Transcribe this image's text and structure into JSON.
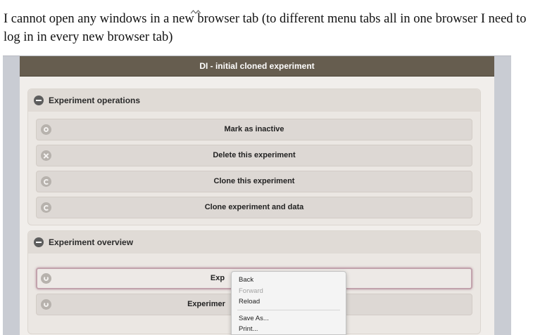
{
  "question_text": "I cannot open any windows in a new browser tab (to different menu tabs all in one browser I need to log in in every new browser tab)",
  "question": {
    "part1": "I cannot open any windows in a new",
    "part2": " browser tab (to different menu tabs all in one browser I need to log in in every new browser tab)"
  },
  "app": {
    "title": "DI - initial cloned experiment"
  },
  "sections": {
    "operations": {
      "title": "Experiment operations",
      "buttons": [
        {
          "label": "Mark as inactive",
          "icon": "gear-icon"
        },
        {
          "label": "Delete this experiment",
          "icon": "delete-icon"
        },
        {
          "label": "Clone this experiment",
          "icon": "refresh-icon"
        },
        {
          "label": "Clone experiment and data",
          "icon": "refresh-icon"
        }
      ]
    },
    "overview": {
      "title": "Experiment overview",
      "buttons": [
        {
          "label": "Exp",
          "icon": "arrow-icon"
        },
        {
          "label": "Experimer",
          "icon": "arrow-icon"
        }
      ]
    }
  },
  "context_menu": {
    "items": [
      {
        "label": "Back",
        "enabled": true
      },
      {
        "label": "Forward",
        "enabled": false
      },
      {
        "label": "Reload",
        "enabled": true
      },
      {
        "label": "Save As...",
        "enabled": true
      },
      {
        "label": "Print...",
        "enabled": true
      }
    ]
  },
  "colors": {
    "titlebar": "#665d4f",
    "section_header": "#e0dbd6",
    "button": "#ddd8d4",
    "active_border": "#c2a3ad"
  }
}
